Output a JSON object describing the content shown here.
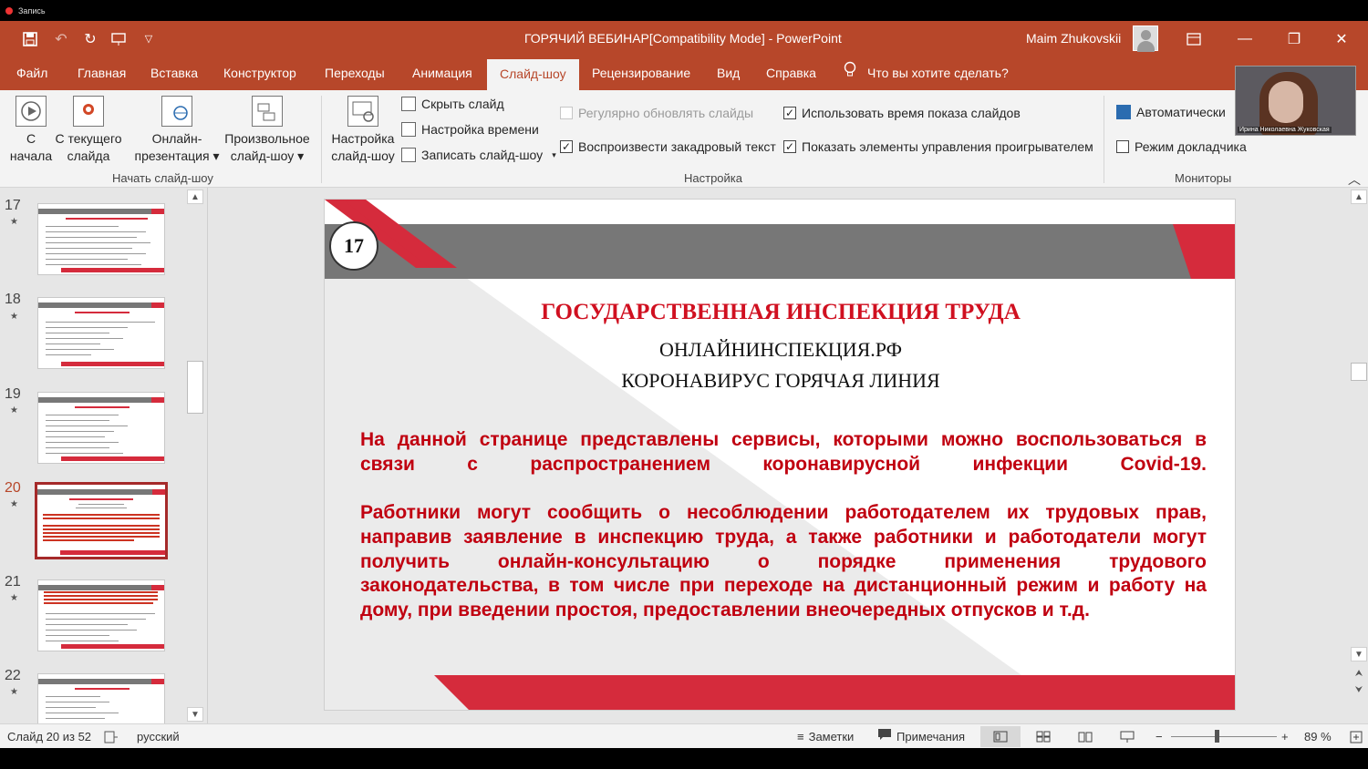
{
  "recorder": {
    "label": "Запись"
  },
  "titlebar": {
    "title": "ГОРЯЧИЙ ВЕБИНАР[Compatibility Mode]  -  PowerPoint",
    "user": "Maim Zhukovskii",
    "icons": [
      "save-icon",
      "undo-icon",
      "redo-icon",
      "present-icon",
      "customize-icon"
    ]
  },
  "tabs": [
    "Файл",
    "Главная",
    "Вставка",
    "Конструктор",
    "Переходы",
    "Анимация",
    "Слайд-шоу",
    "Рецензирование",
    "Вид",
    "Справка"
  ],
  "active_tab": "Слайд-шоу",
  "tell_me": "Что вы хотите сделать?",
  "ribbon": {
    "start": {
      "from_beginning": [
        "С",
        "начала"
      ],
      "from_current": [
        "С текущего",
        "слайда"
      ],
      "online": [
        "Онлайн-",
        "презентация ▾"
      ],
      "custom": [
        "Произвольное",
        "слайд-шоу ▾"
      ],
      "label": "Начать слайд-шоу"
    },
    "setup": {
      "setup_show": [
        "Настройка",
        "слайд-шоу"
      ],
      "hide_slide": "Скрыть слайд",
      "rehearse": "Настройка времени",
      "record": "Записать слайд-шоу",
      "record_arrow": "▾",
      "update_slides": "Регулярно обновлять слайды",
      "play_narrations": "Воспроизвести закадровый текст",
      "use_timings": "Использовать время показа слайдов",
      "show_media": "Показать элементы управления проигрывателем",
      "label": "Настройка"
    },
    "monitors": {
      "monitor_value": "Автоматически",
      "presenter_view": "Режим докладчика",
      "label": "Мониторы"
    }
  },
  "webcam": {
    "name": "Ирина Николаевна Жуковская"
  },
  "thumbnails": [
    {
      "num": "17",
      "star": "★"
    },
    {
      "num": "18",
      "star": "★"
    },
    {
      "num": "19",
      "star": "★"
    },
    {
      "num": "20",
      "star": "★"
    },
    {
      "num": "21",
      "star": "★"
    },
    {
      "num": "22",
      "star": "★"
    }
  ],
  "active_slide": "20",
  "slide": {
    "number": "17",
    "title": "ГОСУДАРСТВЕННАЯ ИНСПЕКЦИЯ ТРУДА",
    "line1": "ОНЛАЙНИНСПЕКЦИЯ.РФ",
    "line2": "КОРОНАВИРУС ГОРЯЧАЯ ЛИНИЯ",
    "para1": [
      "На данной странице представлены сервисы, которыми можно воспользоваться в",
      "связи с распространением коронавирусной инфекции Covid-19."
    ],
    "para2": [
      "Работники могут сообщить о несоблюдении работодателем их трудовых прав,",
      "направив заявление в инспекцию труда, а также работники и работодатели могут",
      "получить онлайн-консультацию о порядке применения трудового",
      "законодательства, в том числе при переходе на дистанционный режим и работу на",
      "дому, при введении простоя, предоставлении внеочередных отпусков и т.д."
    ],
    "colors": {
      "red": "#d52b3c",
      "gray": "#777777",
      "text_red": "#c00010"
    }
  },
  "status": {
    "slide_info": "Слайд 20 из 52",
    "language": "русский",
    "notes": "Заметки",
    "comments": "Примечания",
    "zoom_out": "−",
    "zoom_in": "+",
    "zoom": "89 %"
  }
}
